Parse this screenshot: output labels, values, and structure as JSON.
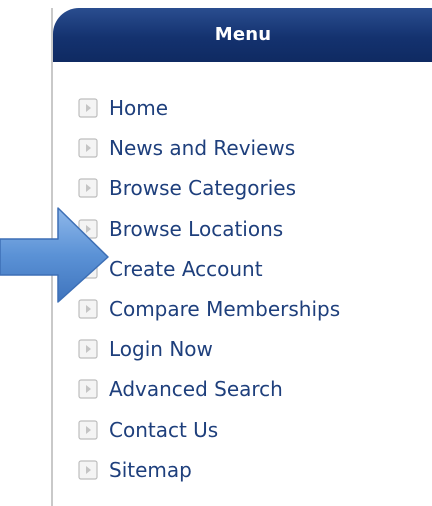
{
  "menu": {
    "title": "Menu",
    "items": [
      {
        "label": "Home"
      },
      {
        "label": "News and Reviews"
      },
      {
        "label": "Browse Categories"
      },
      {
        "label": "Browse Locations"
      },
      {
        "label": "Create Account"
      },
      {
        "label": "Compare Memberships"
      },
      {
        "label": "Login Now"
      },
      {
        "label": "Advanced Search"
      },
      {
        "label": "Contact Us"
      },
      {
        "label": "Sitemap"
      }
    ]
  },
  "icons": {
    "bullet": "play-bullet-icon",
    "pointer": "arrow-right-icon"
  },
  "colors": {
    "header_bg": "#14326f",
    "link_text": "#1e3f7c",
    "arrow": "#5b92d6",
    "bullet_border": "#bdbdbd"
  }
}
